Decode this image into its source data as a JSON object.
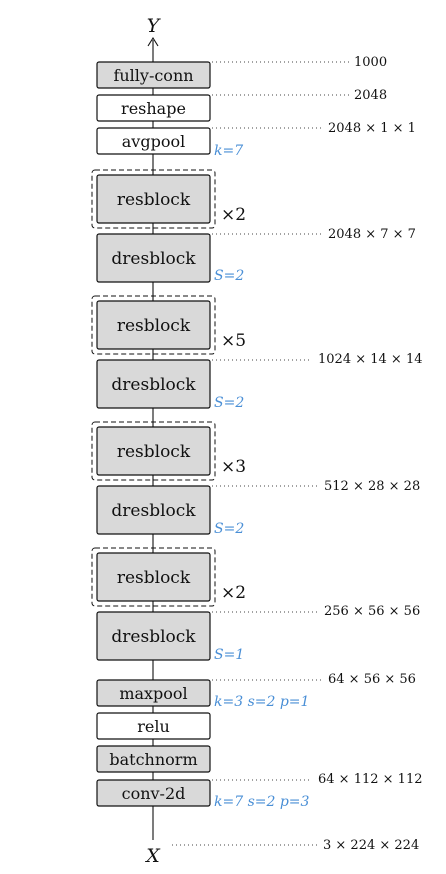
{
  "colors": {
    "gray_fill": "#d9d9d9",
    "white_fill": "#ffffff",
    "stroke": "#111111",
    "param_text": "#4a8fd6"
  },
  "io": {
    "output": "Y",
    "input": "X"
  },
  "layers": [
    {
      "id": "fc",
      "label": "fully-conn",
      "fill": "gray"
    },
    {
      "id": "reshape",
      "label": "reshape",
      "fill": "white"
    },
    {
      "id": "avgpool",
      "label": "avgpool",
      "fill": "white"
    },
    {
      "id": "resblock-4",
      "label": "resblock",
      "fill": "gray",
      "repeat": "×2"
    },
    {
      "id": "dresblock-4",
      "label": "dresblock",
      "fill": "gray"
    },
    {
      "id": "resblock-3",
      "label": "resblock",
      "fill": "gray",
      "repeat": "×5"
    },
    {
      "id": "dresblock-3",
      "label": "dresblock",
      "fill": "gray"
    },
    {
      "id": "resblock-2",
      "label": "resblock",
      "fill": "gray",
      "repeat": "×3"
    },
    {
      "id": "dresblock-2",
      "label": "dresblock",
      "fill": "gray"
    },
    {
      "id": "resblock-1",
      "label": "resblock",
      "fill": "gray",
      "repeat": "×2"
    },
    {
      "id": "dresblock-1",
      "label": "dresblock",
      "fill": "gray"
    },
    {
      "id": "maxpool",
      "label": "maxpool",
      "fill": "gray"
    },
    {
      "id": "relu",
      "label": "relu",
      "fill": "white"
    },
    {
      "id": "batchnorm",
      "label": "batchnorm",
      "fill": "gray"
    },
    {
      "id": "conv2d",
      "label": "conv-2d",
      "fill": "gray"
    }
  ],
  "dimensions": [
    {
      "id": "dim-fc",
      "text": "1000"
    },
    {
      "id": "dim-reshape",
      "text": "2048"
    },
    {
      "id": "dim-avgpool",
      "text": "2048 × 1 × 1"
    },
    {
      "id": "dim-res4",
      "text": "2048 × 7 × 7"
    },
    {
      "id": "dim-res3",
      "text": "1024 × 14 × 14"
    },
    {
      "id": "dim-res2",
      "text": "512 × 28 × 28"
    },
    {
      "id": "dim-res1",
      "text": "256 × 56 × 56"
    },
    {
      "id": "dim-maxpool",
      "text": "64 × 56 × 56"
    },
    {
      "id": "dim-conv",
      "text": "64 × 112 × 112"
    },
    {
      "id": "dim-input",
      "text": "3 × 224 × 224"
    }
  ],
  "params": [
    {
      "id": "param-avgpool",
      "text": "k=7"
    },
    {
      "id": "param-dres4",
      "text": "S=2"
    },
    {
      "id": "param-dres3",
      "text": "S=2"
    },
    {
      "id": "param-dres2",
      "text": "S=2"
    },
    {
      "id": "param-dres1",
      "text": "S=1"
    },
    {
      "id": "param-maxpool",
      "text": "k=3 s=2 p=1"
    },
    {
      "id": "param-conv",
      "text": "k=7 s=2 p=3"
    }
  ]
}
